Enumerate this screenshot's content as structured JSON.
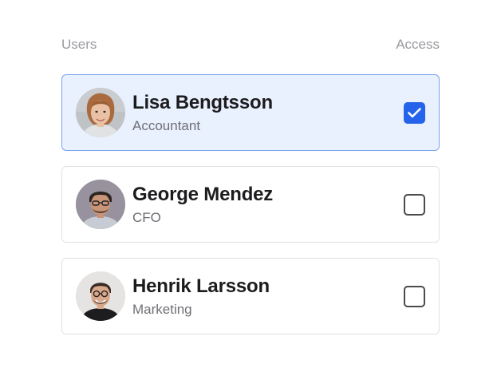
{
  "header": {
    "users_label": "Users",
    "access_label": "Access"
  },
  "users": [
    {
      "name": "Lisa Bengtsson",
      "role": "Accountant",
      "access": true,
      "avatar": "avatar-photo"
    },
    {
      "name": "George Mendez",
      "role": "CFO",
      "access": false,
      "avatar": "avatar-photo"
    },
    {
      "name": "Henrik Larsson",
      "role": "Marketing",
      "access": false,
      "avatar": "avatar-photo"
    }
  ],
  "colors": {
    "accent": "#2563eb",
    "selected_bg": "#e9f0fe",
    "selected_border": "#7ba4ef"
  },
  "icons": {
    "check": "check-icon"
  }
}
